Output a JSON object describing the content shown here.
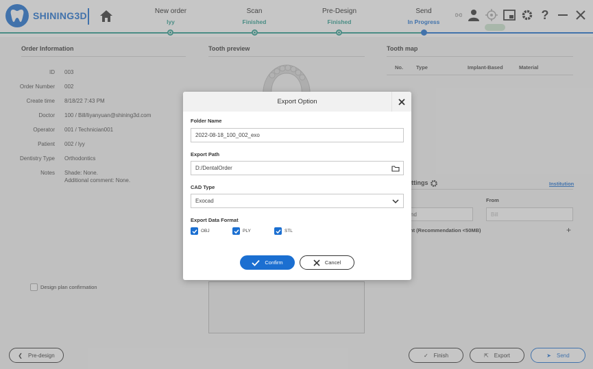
{
  "app": {
    "logo_text": "SHINING3D"
  },
  "steps": [
    {
      "title": "New order",
      "sub": "lyy"
    },
    {
      "title": "Scan",
      "sub": "Finished"
    },
    {
      "title": "Pre-Design",
      "sub": "Finished"
    },
    {
      "title": "Send",
      "sub": "In Progress"
    }
  ],
  "toolbar": {
    "icons": [
      "link-icon",
      "user-icon",
      "target-icon",
      "screenshot-icon",
      "gear-icon",
      "help-icon",
      "minimize-icon",
      "close-icon"
    ]
  },
  "order_info": {
    "title": "Order Information",
    "rows": [
      {
        "label": "ID",
        "value": "003"
      },
      {
        "label": "Order Number",
        "value": "002"
      },
      {
        "label": "Create time",
        "value": "8/18/22 7:43 PM"
      },
      {
        "label": "Doctor",
        "value": "100 / Bill/liyanyuan@shining3d.com"
      },
      {
        "label": "Operator",
        "value": "001 / Technician001"
      },
      {
        "label": "Patient",
        "value": "002 / lyy"
      },
      {
        "label": "Dentistry Type",
        "value": "Orthodontics"
      },
      {
        "label": "Notes",
        "value": "Shade: None.",
        "value2": "Additional comment: None."
      }
    ],
    "design_plan_label": "Design plan confirmation"
  },
  "tooth_preview": {
    "title": "Tooth preview"
  },
  "tooth_map": {
    "title": "Tooth map",
    "columns": [
      "No.",
      "Type",
      "Implant-Based",
      "Material"
    ]
  },
  "settings": {
    "title": "ttings",
    "institution_tab": "Institution",
    "from_label": "From",
    "select_value": "nd",
    "from_value": "Bill",
    "recommendation": "nt (Recommendation <50MB)"
  },
  "bottom": {
    "pre_design": "Pre-design",
    "finish": "Finish",
    "export": "Export",
    "send": "Send"
  },
  "dialog": {
    "title": "Export Option",
    "folder_name_label": "Folder Name",
    "folder_name_value": "2022-08-18_100_002_exo",
    "export_path_label": "Export Path",
    "export_path_value": "D:/DentalOrder",
    "cad_type_label": "CAD Type",
    "cad_type_value": "Exocad",
    "format_label": "Export Data Format",
    "formats": [
      "OBJ",
      "PLY",
      "STL"
    ],
    "confirm": "Confirm",
    "cancel": "Cancel"
  },
  "colors": {
    "accent": "#1b6fd1",
    "finished": "#2a9d8f"
  }
}
